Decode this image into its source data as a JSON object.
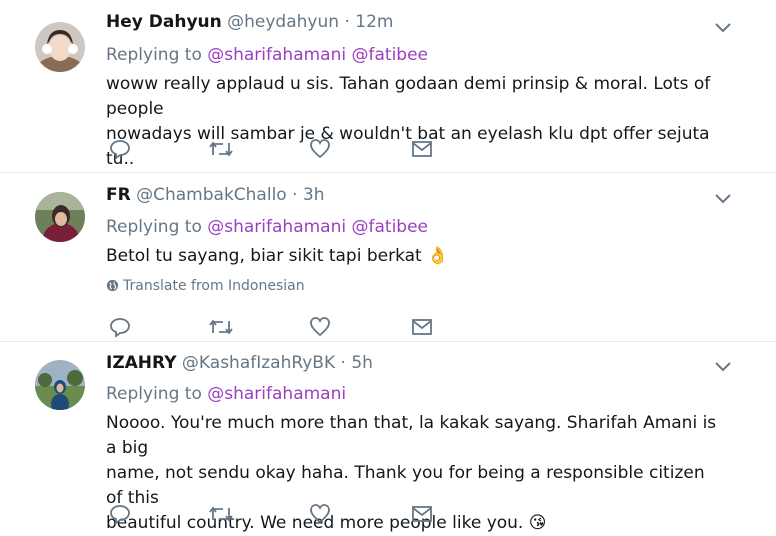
{
  "tweets": [
    {
      "name": "Hey Dahyun",
      "handle": "@heydahyun",
      "separator": "·",
      "time": "12m",
      "replying_prefix": "Replying to",
      "mentions": [
        "@sharifahamani",
        "@fatibee"
      ],
      "lines": [
        "woww really applaud u sis. Tahan godaan demi prinsip & moral. Lots of people",
        "nowadays will sambar je & wouldn't bat an eyelash klu dpt offer sejuta tu.."
      ],
      "emoji": ""
    },
    {
      "name": "FR",
      "handle": "@ChambakChallo",
      "separator": "·",
      "time": "3h",
      "replying_prefix": "Replying to",
      "mentions": [
        "@sharifahamani",
        "@fatibee"
      ],
      "lines": [
        "Betol tu sayang, biar sikit tapi berkat"
      ],
      "emoji": "👌",
      "translate": "Translate from Indonesian"
    },
    {
      "name": "IZAHRY",
      "handle": "@KashafIzahRyBK",
      "separator": "·",
      "time": "5h",
      "replying_prefix": "Replying to",
      "mentions": [
        "@sharifahamani"
      ],
      "lines": [
        "Noooo. You're much more than that, la kakak sayang. Sharifah Amani is a big",
        "name, not sendu okay haha. Thank you for being a responsible citizen of this",
        "beautiful country. We need more people like you."
      ],
      "emoji": "😘"
    }
  ],
  "icons": {
    "reply": "reply-icon",
    "retweet": "retweet-icon",
    "like": "heart-icon",
    "dm": "envelope-icon",
    "caret": "chevron-down-icon",
    "globe": "globe-icon"
  },
  "colors": {
    "mention": "#9b3fbf",
    "secondary": "#657786",
    "text": "#14171a",
    "divider": "#e6ecf0",
    "icon": "#657786"
  }
}
